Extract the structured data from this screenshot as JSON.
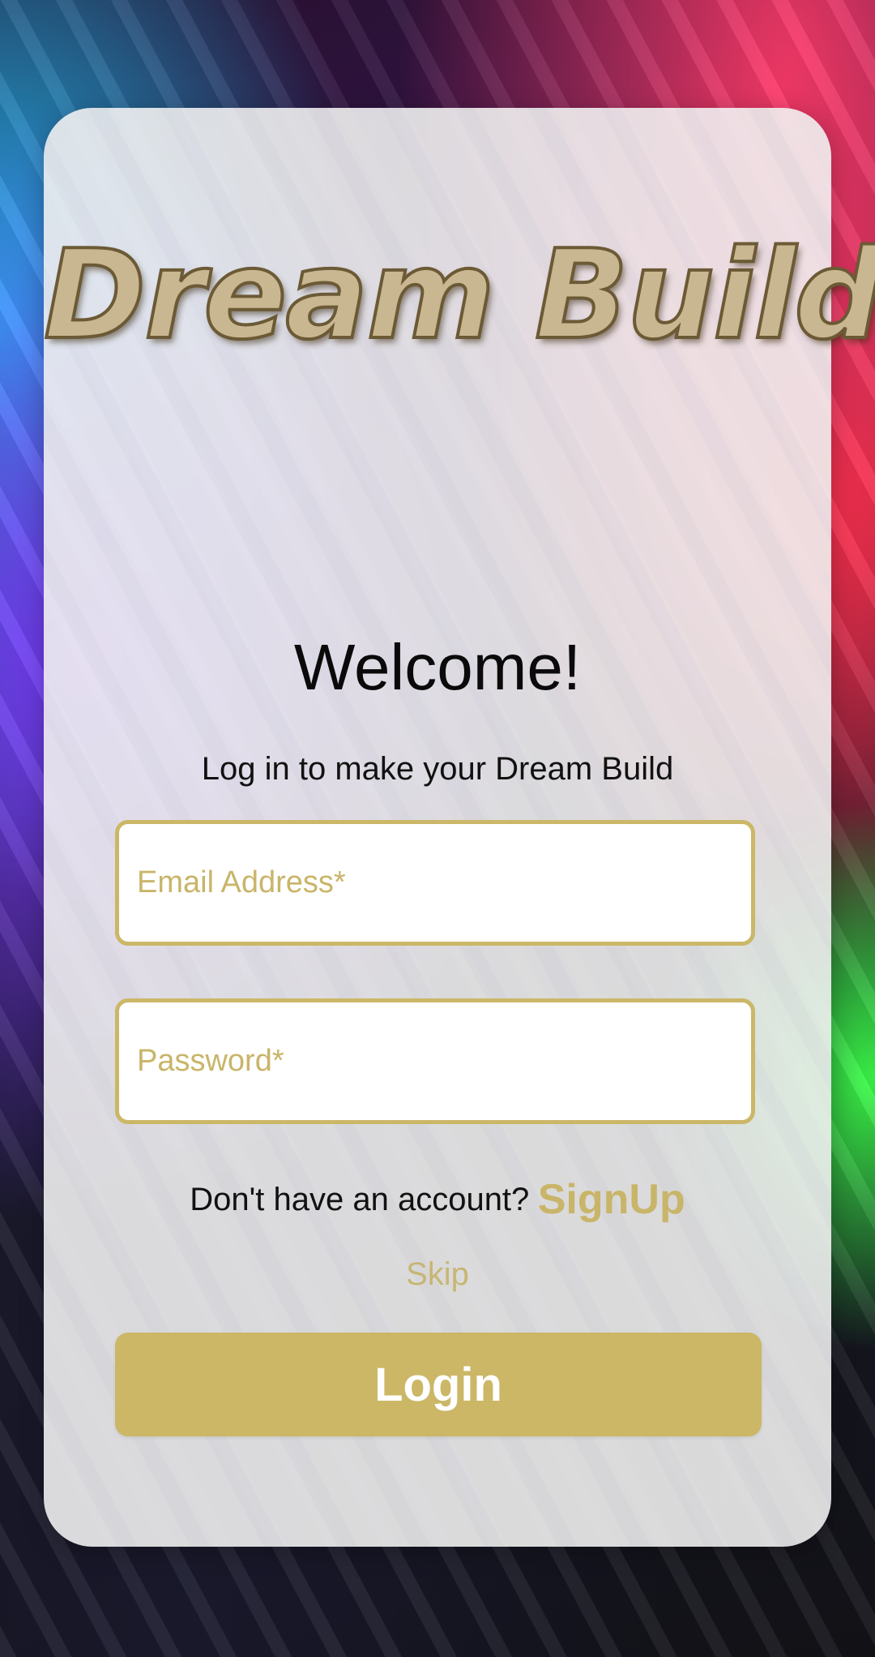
{
  "app": {
    "logo_text": "Dream Build"
  },
  "login": {
    "heading": "Welcome!",
    "subtitle": "Log in to make your Dream Build",
    "email_placeholder": "Email Address*",
    "password_placeholder": "Password*",
    "signup_prompt": "Don't have an account?",
    "signup_link": "SignUp",
    "skip_label": "Skip",
    "login_button": "Login"
  },
  "colors": {
    "accent_gold": "#cbb766",
    "placeholder_gold": "#c9b569",
    "card_background": "#f0f0f0"
  }
}
